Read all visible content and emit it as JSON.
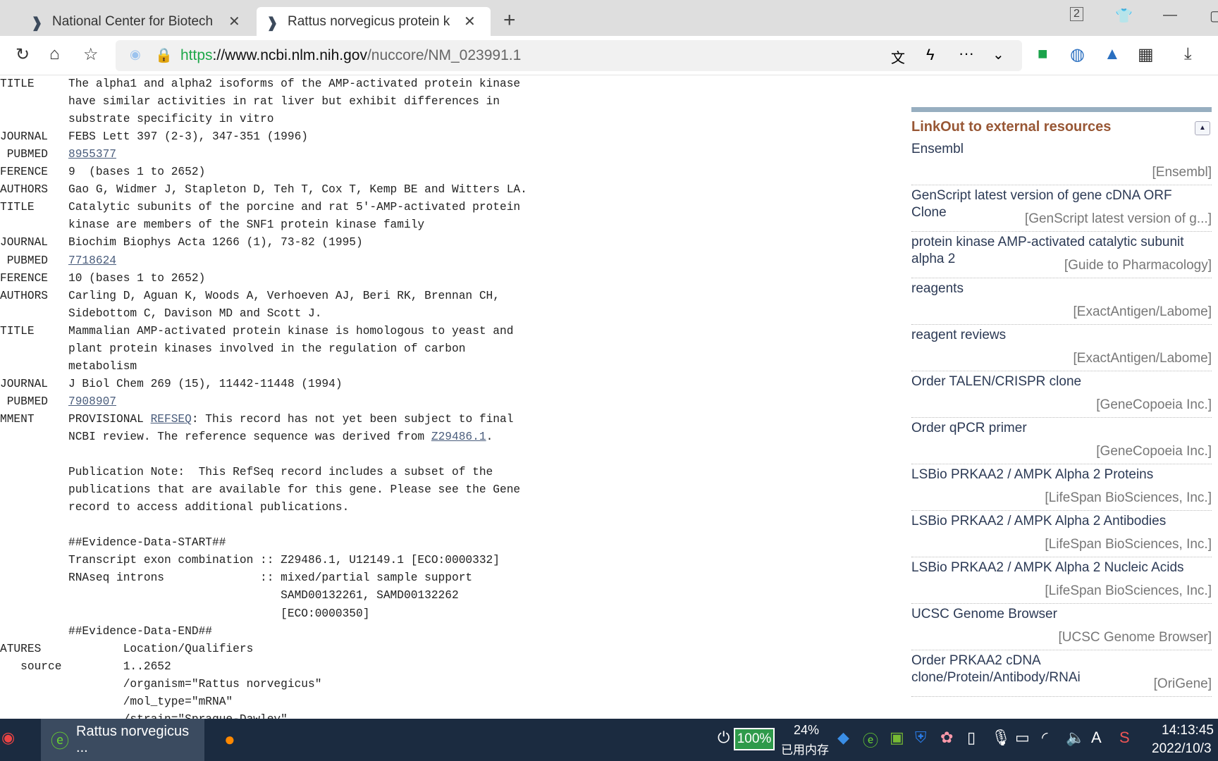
{
  "browser": {
    "tabs": [
      {
        "title": "National Center for Biotech",
        "active": false
      },
      {
        "title": "Rattus norvegicus protein k",
        "active": true
      }
    ],
    "tab_count": "2",
    "url": {
      "scheme": "https",
      "host": "://www.ncbi.nlm.nih.gov",
      "path": "/nuccore/NM_023991.1"
    }
  },
  "record": [
    {
      "label": "TITLE",
      "parts": [
        {
          "t": "The alpha1 and alpha2 isoforms of the AMP-activated protein kinase"
        }
      ]
    },
    {
      "label": "",
      "parts": [
        {
          "t": "have similar activities in rat liver but exhibit differences in"
        }
      ]
    },
    {
      "label": "",
      "parts": [
        {
          "t": "substrate specificity in vitro"
        }
      ]
    },
    {
      "label": "JOURNAL",
      "parts": [
        {
          "t": "FEBS Lett 397 (2-3), 347-351 (1996)"
        }
      ]
    },
    {
      "label": " PUBMED",
      "parts": [
        {
          "t": "8955377",
          "link": true
        }
      ]
    },
    {
      "label": "FERENCE",
      "parts": [
        {
          "t": "9  (bases 1 to 2652)"
        }
      ]
    },
    {
      "label": "AUTHORS",
      "parts": [
        {
          "t": "Gao G, Widmer J, Stapleton D, Teh T, Cox T, Kemp BE and Witters LA."
        }
      ]
    },
    {
      "label": "TITLE",
      "parts": [
        {
          "t": "Catalytic subunits of the porcine and rat 5'-AMP-activated protein"
        }
      ]
    },
    {
      "label": "",
      "parts": [
        {
          "t": "kinase are members of the SNF1 protein kinase family"
        }
      ]
    },
    {
      "label": "JOURNAL",
      "parts": [
        {
          "t": "Biochim Biophys Acta 1266 (1), 73-82 (1995)"
        }
      ]
    },
    {
      "label": " PUBMED",
      "parts": [
        {
          "t": "7718624",
          "link": true
        }
      ]
    },
    {
      "label": "FERENCE",
      "parts": [
        {
          "t": "10 (bases 1 to 2652)"
        }
      ]
    },
    {
      "label": "AUTHORS",
      "parts": [
        {
          "t": "Carling D, Aguan K, Woods A, Verhoeven AJ, Beri RK, Brennan CH,"
        }
      ]
    },
    {
      "label": "",
      "parts": [
        {
          "t": "Sidebottom C, Davison MD and Scott J."
        }
      ]
    },
    {
      "label": "TITLE",
      "parts": [
        {
          "t": "Mammalian AMP-activated protein kinase is homologous to yeast and"
        }
      ]
    },
    {
      "label": "",
      "parts": [
        {
          "t": "plant protein kinases involved in the regulation of carbon"
        }
      ]
    },
    {
      "label": "",
      "parts": [
        {
          "t": "metabolism"
        }
      ]
    },
    {
      "label": "JOURNAL",
      "parts": [
        {
          "t": "J Biol Chem 269 (15), 11442-11448 (1994)"
        }
      ]
    },
    {
      "label": " PUBMED",
      "parts": [
        {
          "t": "7908907",
          "link": true
        }
      ]
    },
    {
      "label": "MMENT",
      "parts": [
        {
          "t": "PROVISIONAL "
        },
        {
          "t": "REFSEQ",
          "link": true
        },
        {
          "t": ": This record has not yet been subject to final"
        }
      ]
    },
    {
      "label": "",
      "parts": [
        {
          "t": "NCBI review. The reference sequence was derived from "
        },
        {
          "t": "Z29486.1",
          "link": true
        },
        {
          "t": "."
        }
      ]
    },
    {
      "label": "",
      "parts": []
    },
    {
      "label": "",
      "parts": [
        {
          "t": "Publication Note:  This RefSeq record includes a subset of the"
        }
      ]
    },
    {
      "label": "",
      "parts": [
        {
          "t": "publications that are available for this gene. Please see the Gene"
        }
      ]
    },
    {
      "label": "",
      "parts": [
        {
          "t": "record to access additional publications."
        }
      ]
    },
    {
      "label": "",
      "parts": []
    },
    {
      "label": "",
      "parts": [
        {
          "t": "##Evidence-Data-START##"
        }
      ]
    },
    {
      "label": "",
      "parts": [
        {
          "t": "Transcript exon combination :: Z29486.1, U12149.1 [ECO:0000332]"
        }
      ]
    },
    {
      "label": "",
      "parts": [
        {
          "t": "RNAseq introns              :: mixed/partial sample support"
        }
      ]
    },
    {
      "label": "",
      "parts": [
        {
          "t": "                               SAMD00132261, SAMD00132262"
        }
      ]
    },
    {
      "label": "",
      "parts": [
        {
          "t": "                               [ECO:0000350]"
        }
      ]
    },
    {
      "label": "",
      "parts": [
        {
          "t": "##Evidence-Data-END##"
        }
      ]
    },
    {
      "label": "ATURES",
      "parts": [
        {
          "t": "        Location/Qualifiers"
        }
      ]
    },
    {
      "label": "   source",
      "parts": [
        {
          "t": "        1..2652"
        }
      ]
    },
    {
      "label": "",
      "parts": [
        {
          "t": "        /organism=\"Rattus norvegicus\""
        }
      ]
    },
    {
      "label": "",
      "parts": [
        {
          "t": "        /mol_type=\"mRNA\""
        }
      ]
    },
    {
      "label": "",
      "parts": [
        {
          "t": "        /strain=\"Sprague-Dawley\""
        }
      ]
    }
  ],
  "linkout": {
    "title": "LinkOut to external resources",
    "items": [
      {
        "name": "Ensembl",
        "provider": "[Ensembl]"
      },
      {
        "name": "GenScript latest version of gene cDNA ORF Clone",
        "provider": "[GenScript latest version of g...]"
      },
      {
        "name": "protein kinase AMP-activated catalytic subunit alpha 2",
        "provider": "[Guide to Pharmacology]"
      },
      {
        "name": "reagents",
        "provider": "[ExactAntigen/Labome]"
      },
      {
        "name": "reagent reviews",
        "provider": "[ExactAntigen/Labome]"
      },
      {
        "name": "Order TALEN/CRISPR clone",
        "provider": "[GeneCopoeia Inc.]"
      },
      {
        "name": "Order qPCR primer",
        "provider": "[GeneCopoeia Inc.]"
      },
      {
        "name": "LSBio PRKAA2 / AMPK Alpha 2 Proteins",
        "provider": "[LifeSpan BioSciences, Inc.]"
      },
      {
        "name": "LSBio PRKAA2 / AMPK Alpha 2 Antibodies",
        "provider": "[LifeSpan BioSciences, Inc.]"
      },
      {
        "name": "LSBio PRKAA2 / AMPK Alpha 2 Nucleic Acids",
        "provider": "[LifeSpan BioSciences, Inc.]"
      },
      {
        "name": "UCSC Genome Browser",
        "provider": "[UCSC Genome Browser]"
      },
      {
        "name": "Order PRKAA2 cDNA clone/Protein/Antibody/RNAi",
        "provider": "[OriGene]"
      }
    ]
  },
  "taskbar": {
    "app_title": "Rattus norvegicus ...",
    "battery": "100%",
    "memory_percent": "24%",
    "memory_label": "已用内存",
    "ime": "A",
    "time": "14:13:45",
    "date": "2022/10/3"
  },
  "colors": {
    "linkout_title": "#985735",
    "link": "#4a5d7c",
    "https": "#1ea84a",
    "taskbar": "#1b2b40"
  }
}
